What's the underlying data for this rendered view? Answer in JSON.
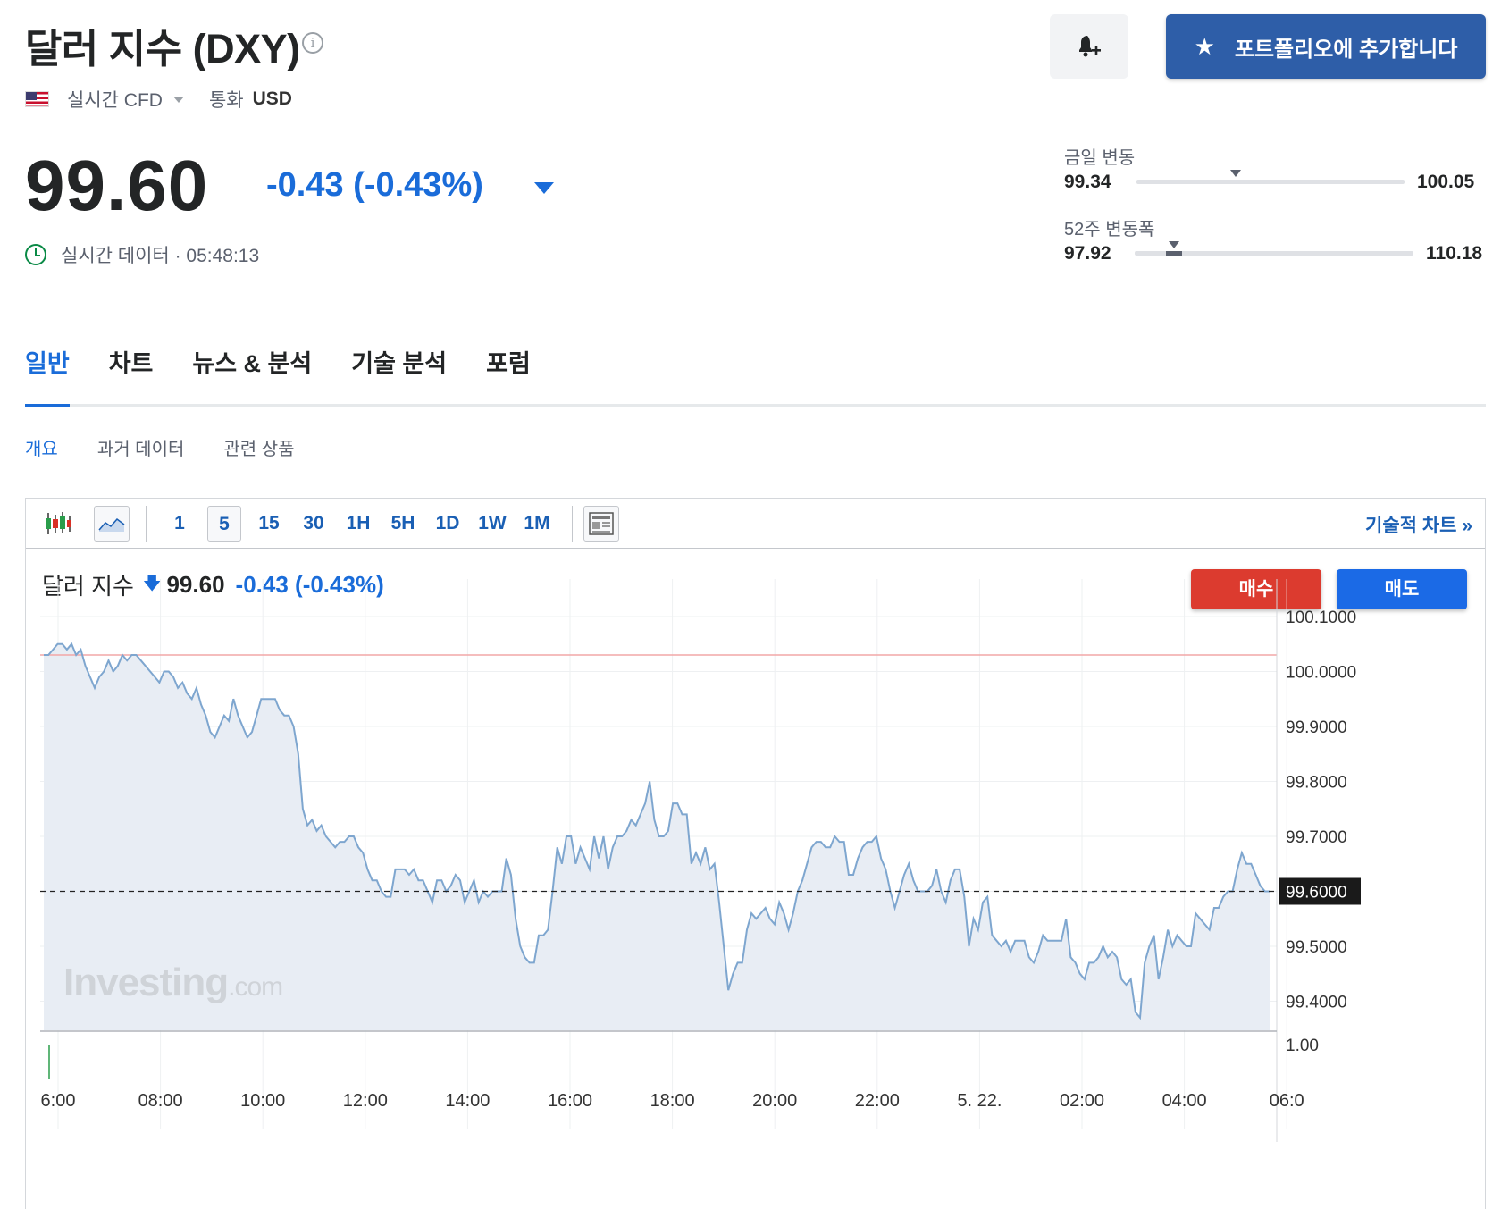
{
  "header": {
    "title": "달러 지수 (DXY)",
    "realtime_label": "실시간 CFD",
    "currency_label": "통화",
    "currency_value": "USD",
    "portfolio_button": "포트폴리오에 추가합니다"
  },
  "quote": {
    "price": "99.60",
    "change": "-0.43 (-0.43%)",
    "realtime_text": "실시간 데이터 · 05:48:13"
  },
  "ranges": {
    "day": {
      "label": "금일 변동",
      "low": "99.34",
      "high": "100.05",
      "position": 0.37
    },
    "week52": {
      "label": "52주 변동폭",
      "low": "97.92",
      "high": "110.18",
      "position": 0.14
    }
  },
  "tabs": [
    {
      "label": "일반",
      "active": true
    },
    {
      "label": "차트",
      "active": false
    },
    {
      "label": "뉴스 & 분석",
      "active": false
    },
    {
      "label": "기술 분석",
      "active": false
    },
    {
      "label": "포럼",
      "active": false
    }
  ],
  "subtabs": [
    {
      "label": "개요",
      "active": true
    },
    {
      "label": "과거 데이터",
      "active": false
    },
    {
      "label": "관련 상품",
      "active": false
    }
  ],
  "toolbar": {
    "intervals": [
      "1",
      "5",
      "15",
      "30",
      "1H",
      "5H",
      "1D",
      "1W",
      "1M"
    ],
    "selected_interval": "5",
    "tech_chart_link": "기술적 차트 »"
  },
  "chart_header": {
    "name": "달러 지수",
    "price": "99.60",
    "change": "-0.43 (-0.43%)",
    "buy_label": "매수",
    "sell_label": "매도"
  },
  "watermark": "Investing.com",
  "colors": {
    "accent": "#1a6cd9",
    "buy": "#dc3b2f",
    "sell": "#1b6ae6",
    "line": "#7ea6cf",
    "area": "#e8edf4",
    "prev_close": "#f2a7a7"
  },
  "chart_data": {
    "type": "area",
    "x_ticks": [
      "6:00",
      "08:00",
      "10:00",
      "12:00",
      "14:00",
      "16:00",
      "18:00",
      "20:00",
      "22:00",
      "5. 22.",
      "02:00",
      "04:00",
      "06:0"
    ],
    "y_ticks": [
      "100.1000",
      "100.0000",
      "99.9000",
      "99.8000",
      "99.7000",
      "99.6000",
      "99.5000",
      "99.4000"
    ],
    "volume_tick": "1.00",
    "current_value": "99.6000",
    "prev_close": 100.03,
    "ylim": [
      99.33,
      100.12
    ],
    "grid": true,
    "series": [
      {
        "values": [
          100.03,
          100.03,
          100.04,
          100.05,
          100.05,
          100.04,
          100.05,
          100.03,
          100.04,
          100.01,
          99.99,
          99.97,
          99.99,
          100.0,
          100.02,
          100.0,
          100.01,
          100.03,
          100.02,
          100.03,
          100.03,
          100.02,
          100.01,
          100.0,
          99.99,
          99.98,
          100.0,
          100.0,
          99.99,
          99.97,
          99.98,
          99.96,
          99.95,
          99.97,
          99.94,
          99.92,
          99.89,
          99.88,
          99.9,
          99.92,
          99.91,
          99.95,
          99.92,
          99.9,
          99.88,
          99.89,
          99.92,
          99.95,
          99.95,
          99.95,
          99.95,
          99.93,
          99.92,
          99.92,
          99.9,
          99.85,
          99.75,
          99.72,
          99.73,
          99.71,
          99.72,
          99.7,
          99.69,
          99.68,
          99.69,
          99.69,
          99.7,
          99.7,
          99.68,
          99.67,
          99.64,
          99.62,
          99.62,
          99.6,
          99.59,
          99.59,
          99.64,
          99.64,
          99.64,
          99.63,
          99.64,
          99.62,
          99.62,
          99.6,
          99.58,
          99.62,
          99.62,
          99.6,
          99.61,
          99.63,
          99.62,
          99.58,
          99.6,
          99.62,
          99.58,
          99.6,
          99.59,
          99.6,
          99.6,
          99.6,
          99.66,
          99.63,
          99.55,
          99.5,
          99.48,
          99.47,
          99.47,
          99.52,
          99.52,
          99.53,
          99.6,
          99.68,
          99.65,
          99.7,
          99.7,
          99.65,
          99.68,
          99.66,
          99.64,
          99.7,
          99.66,
          99.7,
          99.64,
          99.68,
          99.7,
          99.7,
          99.71,
          99.73,
          99.72,
          99.74,
          99.76,
          99.8,
          99.73,
          99.7,
          99.7,
          99.71,
          99.76,
          99.76,
          99.74,
          99.74,
          99.65,
          99.67,
          99.65,
          99.68,
          99.64,
          99.65,
          99.58,
          99.5,
          99.42,
          99.45,
          99.47,
          99.47,
          99.53,
          99.56,
          99.55,
          99.56,
          99.57,
          99.55,
          99.54,
          99.58,
          99.56,
          99.53,
          99.56,
          99.6,
          99.62,
          99.65,
          99.68,
          99.69,
          99.69,
          99.68,
          99.68,
          99.7,
          99.69,
          99.69,
          99.63,
          99.63,
          99.66,
          99.68,
          99.69,
          99.69,
          99.7,
          99.66,
          99.64,
          99.6,
          99.57,
          99.6,
          99.63,
          99.65,
          99.62,
          99.6,
          99.6,
          99.6,
          99.61,
          99.64,
          99.6,
          99.58,
          99.62,
          99.64,
          99.64,
          99.59,
          99.5,
          99.55,
          99.53,
          99.58,
          99.59,
          99.52,
          99.51,
          99.5,
          99.51,
          99.49,
          99.51,
          99.51,
          99.51,
          99.48,
          99.47,
          99.49,
          99.52,
          99.51,
          99.51,
          99.51,
          99.51,
          99.55,
          99.48,
          99.47,
          99.45,
          99.44,
          99.47,
          99.47,
          99.48,
          99.5,
          99.48,
          99.49,
          99.48,
          99.44,
          99.43,
          99.44,
          99.38,
          99.37,
          99.47,
          99.5,
          99.52,
          99.44,
          99.48,
          99.53,
          99.5,
          99.52,
          99.51,
          99.5,
          99.5,
          99.56,
          99.55,
          99.54,
          99.53,
          99.57,
          99.57,
          99.59,
          99.6,
          99.6,
          99.64,
          99.67,
          99.65,
          99.65,
          99.63,
          99.61,
          99.6,
          99.6
        ]
      }
    ]
  }
}
